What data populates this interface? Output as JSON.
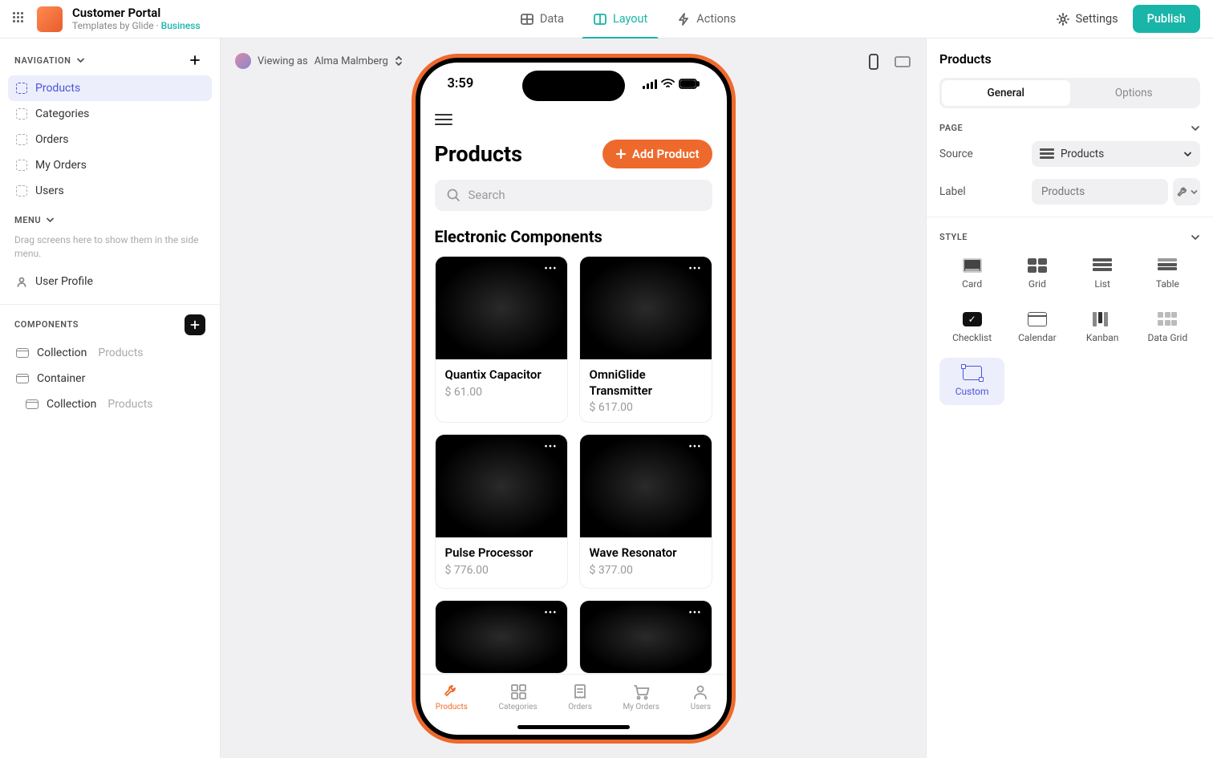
{
  "topbar": {
    "app_title": "Customer Portal",
    "subtitle_prefix": "Templates by Glide",
    "subtitle_sep": " · ",
    "plan": "Business",
    "tabs": {
      "data": "Data",
      "layout": "Layout",
      "actions": "Actions"
    },
    "settings": "Settings",
    "publish": "Publish"
  },
  "left": {
    "nav_title": "NAVIGATION",
    "nav_items": [
      "Products",
      "Categories",
      "Orders",
      "My Orders",
      "Users"
    ],
    "menu_title": "MENU",
    "menu_hint": "Drag screens here to show them in the side menu.",
    "user_profile": "User Profile",
    "components_title": "COMPONENTS",
    "components": [
      {
        "label": "Collection",
        "sub": "Products"
      },
      {
        "label": "Container",
        "sub": ""
      },
      {
        "label": "Collection",
        "sub": "Products"
      }
    ]
  },
  "canvas": {
    "viewing_prefix": "Viewing as ",
    "viewing_user": "Alma Malmberg",
    "clock": "3:59",
    "screen_title": "Products",
    "add_product": "Add Product",
    "search_placeholder": "Search",
    "category_title": "Electronic Components",
    "products": [
      {
        "name": "Quantix Capacitor",
        "price": "$ 61.00"
      },
      {
        "name": "OmniGlide Transmitter",
        "price": "$ 617.00"
      },
      {
        "name": "Pulse Processor",
        "price": "$ 776.00"
      },
      {
        "name": "Wave Resonator",
        "price": "$ 377.00"
      },
      {
        "name": "",
        "price": ""
      },
      {
        "name": "",
        "price": ""
      }
    ],
    "tabs": [
      "Products",
      "Categories",
      "Orders",
      "My Orders",
      "Users"
    ]
  },
  "right": {
    "title": "Products",
    "seg": {
      "general": "General",
      "options": "Options"
    },
    "page_section": "PAGE",
    "source_label": "Source",
    "source_value": "Products",
    "label_label": "Label",
    "label_value": "Products",
    "style_section": "STYLE",
    "styles": [
      "Card",
      "Grid",
      "List",
      "Table",
      "Checklist",
      "Calendar",
      "Kanban",
      "Data Grid",
      "Custom"
    ]
  }
}
